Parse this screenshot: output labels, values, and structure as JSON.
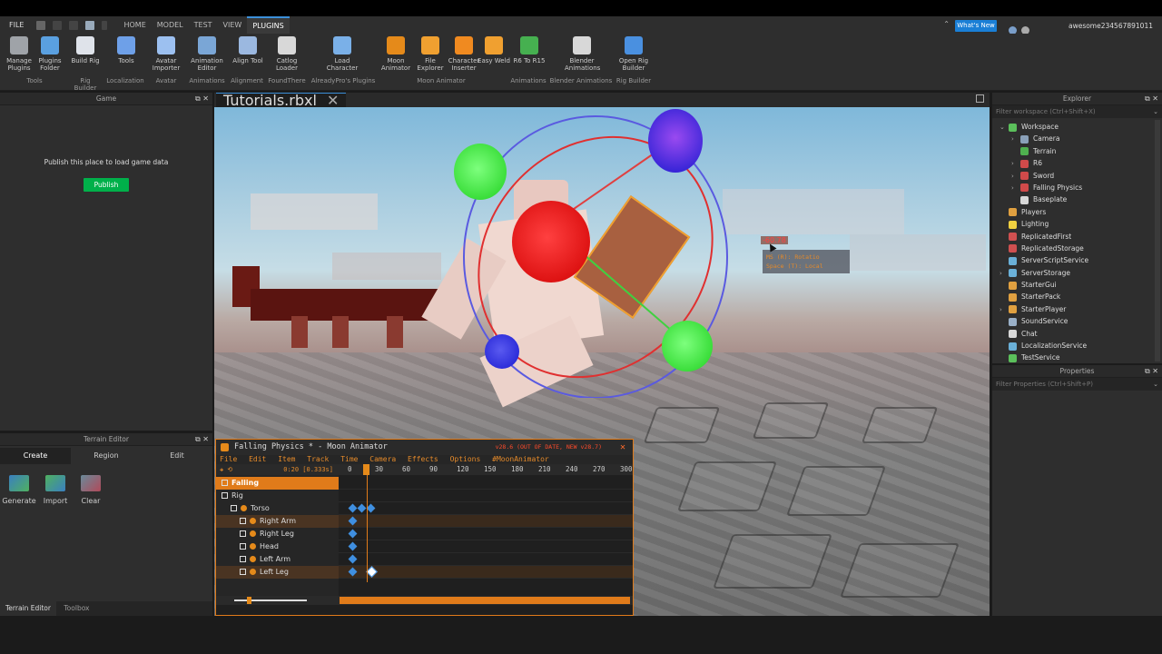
{
  "menu": {
    "file": "FILE",
    "tabs": [
      "HOME",
      "MODEL",
      "TEST",
      "VIEW",
      "PLUGINS"
    ],
    "active_tab": "PLUGINS",
    "whats_new": "What's New",
    "username": "awesome234567891011"
  },
  "ribbon": {
    "tools": [
      {
        "label": "Manage Plugins",
        "icon": "gear-icon",
        "color": "#9fa3a8"
      },
      {
        "label": "Plugins Folder",
        "icon": "folder-icon",
        "color": "#5aa0e0"
      },
      {
        "label": "Build Rig",
        "icon": "rig-icon",
        "color": "#dfe3ea"
      },
      {
        "label": "Tools",
        "icon": "globe-icon",
        "color": "#6ea0e8"
      },
      {
        "label": "Avatar Importer",
        "icon": "avatar-icon",
        "color": "#9cc0f0"
      },
      {
        "label": "Animation Editor",
        "icon": "animation-icon",
        "color": "#7aa6d6"
      },
      {
        "label": "Align Tool",
        "icon": "align-icon",
        "color": "#9bb8e0"
      },
      {
        "label": "Catlog Loader",
        "icon": "download-icon",
        "color": "#d8d8d8"
      },
      {
        "label": "Load Character",
        "icon": "character-icon",
        "color": "#7ab0e8"
      },
      {
        "label": "Moon Animator",
        "icon": "moon-icon",
        "color": "#e58a1a"
      },
      {
        "label": "File Explorer",
        "icon": "folder-icon",
        "color": "#f0a030"
      },
      {
        "label": "Character Inserter",
        "icon": "character-icon",
        "color": "#f08a20"
      },
      {
        "label": "Easy Weld",
        "icon": "wrench-icon",
        "color": "#f0a030"
      },
      {
        "label": "R6 To R15",
        "icon": "convert-icon",
        "color": "#46b050"
      },
      {
        "label": "Blender Animations",
        "icon": "blender-icon",
        "color": "#d8d8d8"
      },
      {
        "label": "Open Rig Builder",
        "icon": "rig-builder-icon",
        "color": "#4a90e0"
      }
    ],
    "groups": [
      "Tools",
      "Rig Builder",
      "Localization",
      "Avatar",
      "Animations",
      "Alignment",
      "FoundThere",
      "AlreadyPro's Plugins",
      "Moon Animator",
      "Animations",
      "Blender Animations",
      "Rig Builder"
    ]
  },
  "game_panel": {
    "title": "Game",
    "message": "Publish this place to load game data",
    "publish_label": "Publish"
  },
  "terrain_editor": {
    "title": "Terrain Editor",
    "tabs": [
      "Create",
      "Region",
      "Edit"
    ],
    "active_tab": "Create",
    "buttons": [
      {
        "label": "Generate",
        "icon": "generate-icon"
      },
      {
        "label": "Import",
        "icon": "import-icon"
      },
      {
        "label": "Clear",
        "icon": "clear-icon"
      }
    ]
  },
  "bottom_tabs": [
    "Terrain Editor",
    "Toolbox"
  ],
  "document": {
    "tab_label": "Tutorials.rbxl"
  },
  "viewport": {
    "tooltip_value": "-60.78",
    "tooltip_line1": "Rotatio",
    "tooltip_line1_prefix": "MS (R):",
    "tooltip_line2": "Space (T): Local"
  },
  "explorer": {
    "title": "Explorer",
    "filter_placeholder": "Filter workspace (Ctrl+Shift+X)",
    "items": [
      {
        "label": "Workspace",
        "indent": 0,
        "expander": "expanded",
        "color": "#5bc05b"
      },
      {
        "label": "Camera",
        "indent": 1,
        "expander": "collapsed",
        "color": "#8aa0b8"
      },
      {
        "label": "Terrain",
        "indent": 1,
        "expander": "",
        "color": "#4fb04f"
      },
      {
        "label": "R6",
        "indent": 1,
        "expander": "collapsed",
        "color": "#d04a4a"
      },
      {
        "label": "Sword",
        "indent": 1,
        "expander": "collapsed",
        "color": "#d04a4a"
      },
      {
        "label": "Falling Physics",
        "indent": 1,
        "expander": "collapsed",
        "color": "#d04a4a"
      },
      {
        "label": "Baseplate",
        "indent": 1,
        "expander": "",
        "color": "#d8d8d8"
      },
      {
        "label": "Players",
        "indent": 0,
        "expander": "",
        "color": "#e0a040"
      },
      {
        "label": "Lighting",
        "indent": 0,
        "expander": "",
        "color": "#f0d040"
      },
      {
        "label": "ReplicatedFirst",
        "indent": 0,
        "expander": "",
        "color": "#d05050"
      },
      {
        "label": "ReplicatedStorage",
        "indent": 0,
        "expander": "",
        "color": "#d05050"
      },
      {
        "label": "ServerScriptService",
        "indent": 0,
        "expander": "",
        "color": "#6ab0d8"
      },
      {
        "label": "ServerStorage",
        "indent": 0,
        "expander": "collapsed",
        "color": "#6ab0d8"
      },
      {
        "label": "StarterGui",
        "indent": 0,
        "expander": "",
        "color": "#e0a040"
      },
      {
        "label": "StarterPack",
        "indent": 0,
        "expander": "",
        "color": "#e0a040"
      },
      {
        "label": "StarterPlayer",
        "indent": 0,
        "expander": "collapsed",
        "color": "#e0a040"
      },
      {
        "label": "SoundService",
        "indent": 0,
        "expander": "",
        "color": "#9ab0c8"
      },
      {
        "label": "Chat",
        "indent": 0,
        "expander": "",
        "color": "#d8d8d8"
      },
      {
        "label": "LocalizationService",
        "indent": 0,
        "expander": "",
        "color": "#6ab0d8"
      },
      {
        "label": "TestService",
        "indent": 0,
        "expander": "",
        "color": "#5bc05b"
      }
    ]
  },
  "properties": {
    "title": "Properties",
    "filter_placeholder": "Filter Properties (Ctrl+Shift+P)"
  },
  "moon_animator": {
    "title": "Falling Physics * - Moon Animator",
    "version_note": "v28.6 (OUT OF DATE, NEW v28.7)",
    "menu": [
      "File",
      "Edit",
      "Item",
      "Track",
      "Time",
      "Camera",
      "Effects",
      "Options",
      "#MoonAnimator"
    ],
    "time_display": "0:20 [0.333s]",
    "ruler": [
      "0",
      "30",
      "60",
      "90",
      "120",
      "150",
      "180",
      "210",
      "240",
      "270",
      "300"
    ],
    "tracks": [
      {
        "label": "Falling",
        "level": 0,
        "header": true
      },
      {
        "label": "Rig",
        "level": 0
      },
      {
        "label": "Torso",
        "level": 1,
        "keys": [
          0,
          10,
          20
        ]
      },
      {
        "label": "Right Arm",
        "level": 2,
        "keys": [
          0
        ],
        "highlight": true
      },
      {
        "label": "Right Leg",
        "level": 2,
        "keys": [
          0
        ]
      },
      {
        "label": "Head",
        "level": 2,
        "keys": [
          0
        ]
      },
      {
        "label": "Left Arm",
        "level": 2,
        "keys": [
          0
        ]
      },
      {
        "label": "Left Leg",
        "level": 2,
        "keys": [
          0,
          20
        ],
        "highlight": true
      }
    ],
    "colors": {
      "accent": "#e58a1a",
      "key": "#3f8fe0",
      "version": "#ff4b2b"
    }
  }
}
